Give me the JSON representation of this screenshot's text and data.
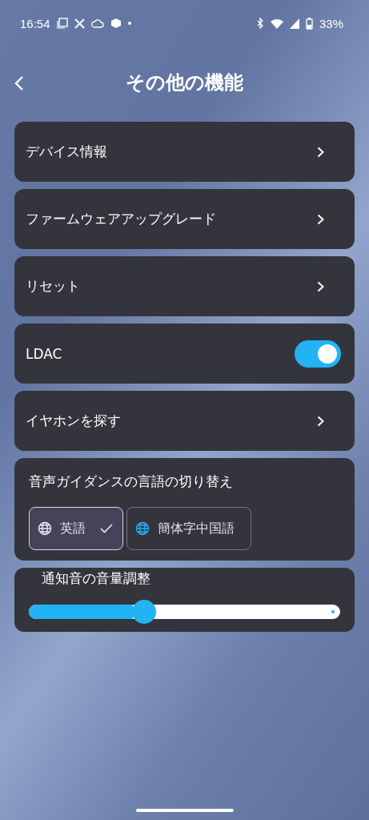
{
  "status_bar": {
    "time": "16:54",
    "battery": "33%"
  },
  "header": {
    "title": "その他の機能"
  },
  "items": [
    {
      "kind": "link",
      "label": "デバイス情報"
    },
    {
      "kind": "link",
      "label": "ファームウェアアップグレード"
    },
    {
      "kind": "link",
      "label": "リセット"
    },
    {
      "kind": "toggle",
      "label": "LDAC",
      "on": true
    },
    {
      "kind": "link",
      "label": "イヤホンを探す"
    }
  ],
  "language": {
    "title": "音声ガイダンスの言語の切り替え",
    "options": [
      {
        "label": "英語",
        "selected": true
      },
      {
        "label": "簡体字中国語",
        "selected": false
      }
    ]
  },
  "volume": {
    "title": "通知音の音量調整",
    "level": 0.37
  }
}
